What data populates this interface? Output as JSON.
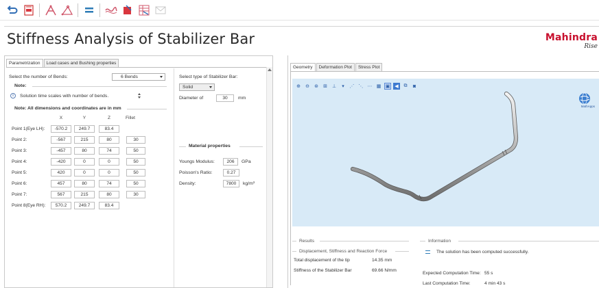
{
  "toolbar": {
    "buttons": [
      {
        "name": "undo-icon"
      },
      {
        "name": "save-pdf-icon"
      },
      {
        "name": "geometry-a-icon"
      },
      {
        "name": "geometry-b-icon"
      },
      {
        "name": "equals-icon"
      },
      {
        "name": "curve-icon"
      },
      {
        "name": "stop-icon"
      },
      {
        "name": "table-icon"
      },
      {
        "name": "mail-icon"
      }
    ]
  },
  "header": {
    "title": "Stiffness Analysis of Stabilizer Bar",
    "brand": "Mahindra",
    "brand_sub": "Rise"
  },
  "left": {
    "tabs": [
      "Parametrization",
      "Load cases and Bushing properties"
    ],
    "bends_label": "Select the number of Bends:",
    "bends_value": "6 Bends",
    "note_label": "Note:",
    "note_text": "Solution time scales with number of bends.",
    "dims_note": "Note: All dimensions and coordinates are in mm",
    "columns": [
      "X",
      "Y",
      "Z",
      "Fillet"
    ],
    "rows": [
      {
        "label": "Point 1(Eye LH):",
        "x": "-570.2",
        "y": "249.7",
        "z": "83.4",
        "fillet": ""
      },
      {
        "label": "Point 2:",
        "x": "-567",
        "y": "215",
        "z": "80",
        "fillet": "30"
      },
      {
        "label": "Point 3:",
        "x": "-457",
        "y": "80",
        "z": "74",
        "fillet": "50"
      },
      {
        "label": "Point 4:",
        "x": "-420",
        "y": "0",
        "z": "0",
        "fillet": "50"
      },
      {
        "label": "Point 5:",
        "x": "420",
        "y": "0",
        "z": "0",
        "fillet": "50"
      },
      {
        "label": "Point 6:",
        "x": "457",
        "y": "80",
        "z": "74",
        "fillet": "50"
      },
      {
        "label": "Point 7:",
        "x": "567",
        "y": "215",
        "z": "80",
        "fillet": "30"
      },
      {
        "label": "Point 8(Eye RH):",
        "x": "570.2",
        "y": "249.7",
        "z": "83.4",
        "fillet": ""
      }
    ],
    "bar_type_label": "Select type of Stabilizer Bar:",
    "bar_type_value": "Solid",
    "diameter_label": "Diameter of",
    "diameter_value": "30",
    "diameter_unit": "mm",
    "material_title": "Material properties",
    "youngs_label": "Youngs Modulus:",
    "youngs_value": "206",
    "youngs_unit": "GPa",
    "poisson_label": "Poisson's Ratio:",
    "poisson_value": "0.27",
    "density_label": "Density:",
    "density_value": "7800",
    "density_unit": "kg/m³"
  },
  "right": {
    "tabs": [
      "Geometry",
      "Deformation Plot",
      "Stress Plot"
    ],
    "mathapps_label": "MathApps",
    "results_title": "Results",
    "disp_section": "Displacement, Stiffness and Reaction Force",
    "total_disp_label": "Total displacement of the tip",
    "total_disp_value": "14.35 mm",
    "stiffness_label": "Stiffness of the Stabilizer Bar",
    "stiffness_value": "69.66 N/mm",
    "info_title": "Information",
    "info_message": "The solution has been computed successfully.",
    "expected_label": "Expected Computation Time:",
    "expected_value": "55 s",
    "last_label": "Last Computation Time:",
    "last_value": "4 min 43 s"
  },
  "colors": {
    "brand_red": "#c8102e",
    "viewport_bg": "#d8eaf7",
    "accent_blue": "#2c7bb6"
  }
}
